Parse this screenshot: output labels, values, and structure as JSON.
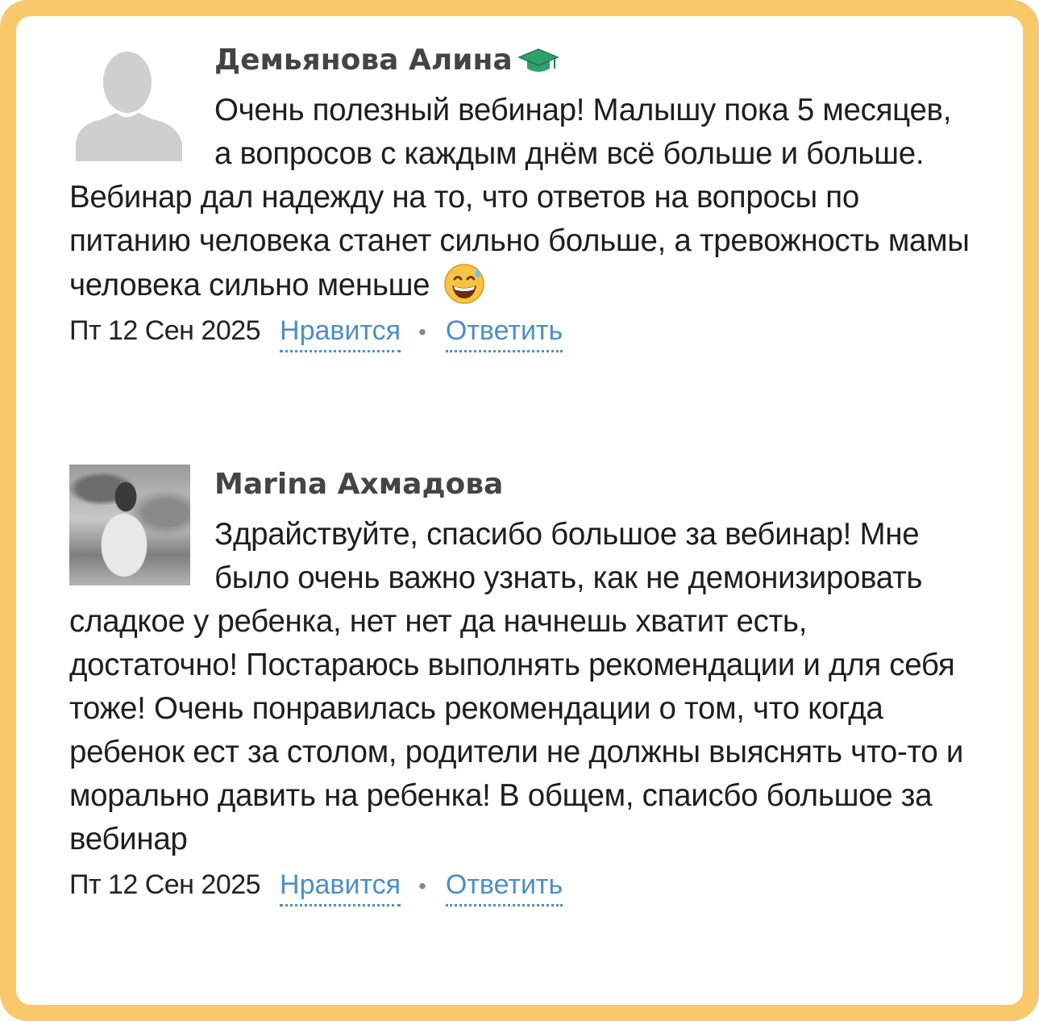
{
  "comments": [
    {
      "author": "Демьянова Алина",
      "author_badge_icon": "graduation-cap-icon",
      "text": "Очень полезный вебинар! Малышу пока 5 месяцев, а вопросов с каждым днём всё больше и больше. Вебинар дал надежду на то, что ответов на вопросы по питанию человека станет сильно больше, а тревожность мамы человека сильно меньше",
      "text_emoji_icon": "grinning-sweat-emoji-icon",
      "date": "Пт 12 Сен 2025",
      "like_label": "Нравится",
      "separator": "•",
      "reply_label": "Ответить"
    },
    {
      "author": "Marina Ахмадова",
      "text": "Здрайствуйте, спасибо большое за вебинар! Мне было очень важно узнать, как не демонизировать сладкое у ребенка, нет нет да начнешь хватит есть, достаточно! Постараюсь выполнять рекомендации и для себя тоже! Очень понравилась рекомендации о том, что когда ребенок ест за столом, родители не должны выяснять что-то и морально давить на ребенка! В общем, спаисбо большое за вебинар",
      "date": "Пт 12 Сен 2025",
      "like_label": "Нравится",
      "separator": "•",
      "reply_label": "Ответить"
    }
  ],
  "colors": {
    "frame": "#f8c86a",
    "link": "#4b8fc7",
    "author": "#444444",
    "badge": "#2ea06a"
  }
}
